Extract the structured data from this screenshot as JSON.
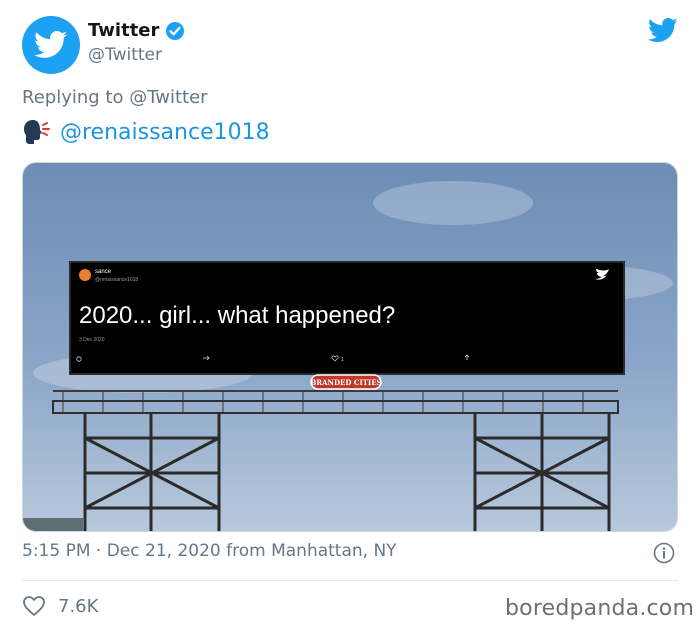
{
  "tweet": {
    "author_name": "Twitter",
    "author_handle": "@Twitter",
    "replying_prefix": "Replying to",
    "replying_to": "@Twitter",
    "mention": "@renaissance1018",
    "timestamp": "5:15 PM · Dec 21, 2020 from Manhattan, NY",
    "likes": "7.6K"
  },
  "billboard": {
    "user_name": "sance",
    "user_handle": "@renaissance1018",
    "text": "2020... girl... what happened?",
    "date": "3 Dec 2020",
    "like_count": "1",
    "brand": "BRANDED CITIES"
  },
  "watermark": "boredpanda.com",
  "colors": {
    "accent": "#1da1f2",
    "link": "#1b95e0",
    "muted": "#657786",
    "sky_top": "#6d8db6",
    "sky_bottom": "#b9c9dc",
    "billboard_bg": "#000000"
  },
  "icons": [
    "twitter-bird-icon",
    "verified-badge-icon",
    "speaking-head-icon",
    "info-icon",
    "heart-icon"
  ]
}
